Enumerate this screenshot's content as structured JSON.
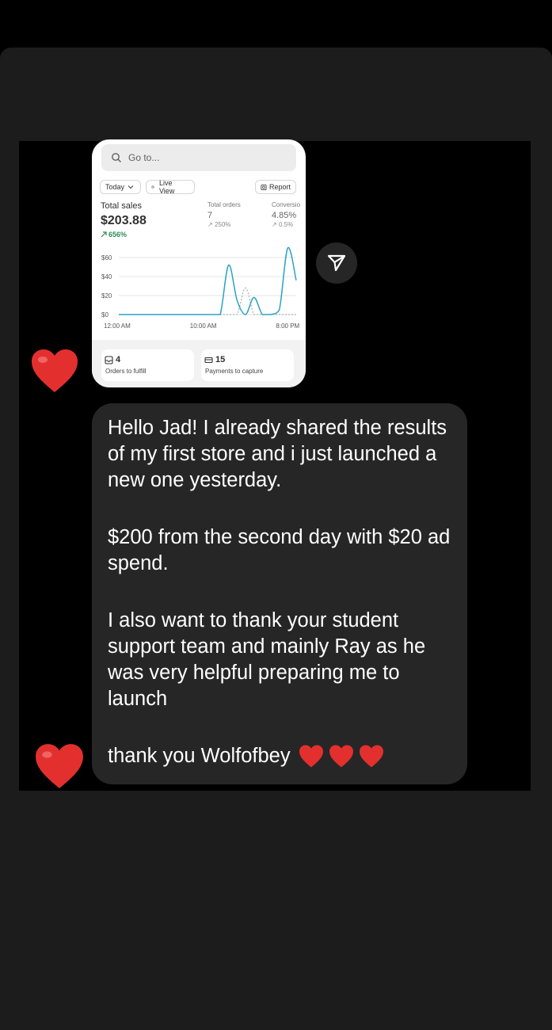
{
  "card": {
    "search_placeholder": "Go to...",
    "today_label": "Today",
    "live_view_label": "Live View",
    "report_label": "Report",
    "total_sales_label": "Total sales",
    "total_sales_value": "$203.88",
    "total_sales_delta": "656%",
    "total_orders_label": "Total orders",
    "total_orders_value": "7",
    "total_orders_delta": "250%",
    "conversion_label": "Conversio",
    "conversion_value": "4.85%",
    "conversion_delta": "0.5%",
    "orders_to_fulfill_count": "4",
    "orders_to_fulfill_label": "Orders to fulfill",
    "payments_count": "15",
    "payments_label": "Payments to capture"
  },
  "chart_data": {
    "type": "line",
    "title": "",
    "xlabel": "",
    "ylabel": "",
    "y_ticks": [
      "$60",
      "$40",
      "$20",
      "$0"
    ],
    "x_ticks": [
      "12:00 AM",
      "10:00 AM",
      "8:00 PM"
    ],
    "ylim": [
      0,
      60
    ],
    "x": [
      "12:00 AM",
      "1 AM",
      "2 AM",
      "3 AM",
      "4 AM",
      "5 AM",
      "6 AM",
      "7 AM",
      "8 AM",
      "9 AM",
      "10:00 AM",
      "11 AM",
      "12 PM",
      "1 PM",
      "2 PM",
      "3 PM",
      "4 PM",
      "5 PM",
      "6 PM",
      "7 PM",
      "8:00 PM",
      "9 PM"
    ],
    "series": [
      {
        "values": [
          0,
          0,
          0,
          0,
          0,
          0,
          0,
          0,
          0,
          0,
          0,
          0,
          0,
          52,
          15,
          0,
          18,
          0,
          0,
          5,
          70,
          36
        ],
        "color": "#2ba3c4"
      },
      {
        "values": [
          0,
          0,
          0,
          0,
          0,
          0,
          0,
          0,
          0,
          0,
          0,
          0,
          0,
          0,
          0,
          28,
          0,
          0,
          0,
          0,
          0,
          0
        ],
        "color": "#9aa0a6"
      }
    ],
    "grid": true
  },
  "message": {
    "p1": "Hello Jad! I already shared the results of my first store and i just launched a new one yesterday.",
    "p2": "$200 from the second day with $20 ad spend.",
    "p3": "I also want to thank your student support team and mainly Ray as he was very helpful preparing me to launch",
    "p4": "thank you Wolfofbey"
  },
  "colors": {
    "heart": "#e3302f",
    "bubble": "#262626",
    "accent_green": "#2e8b57",
    "chart_line": "#2ba3c4"
  },
  "icons": [
    "search-icon",
    "chevron-down-icon",
    "report-icon",
    "inbox-icon",
    "payments-icon",
    "send-icon",
    "heart-icon",
    "trend-up-icon"
  ]
}
